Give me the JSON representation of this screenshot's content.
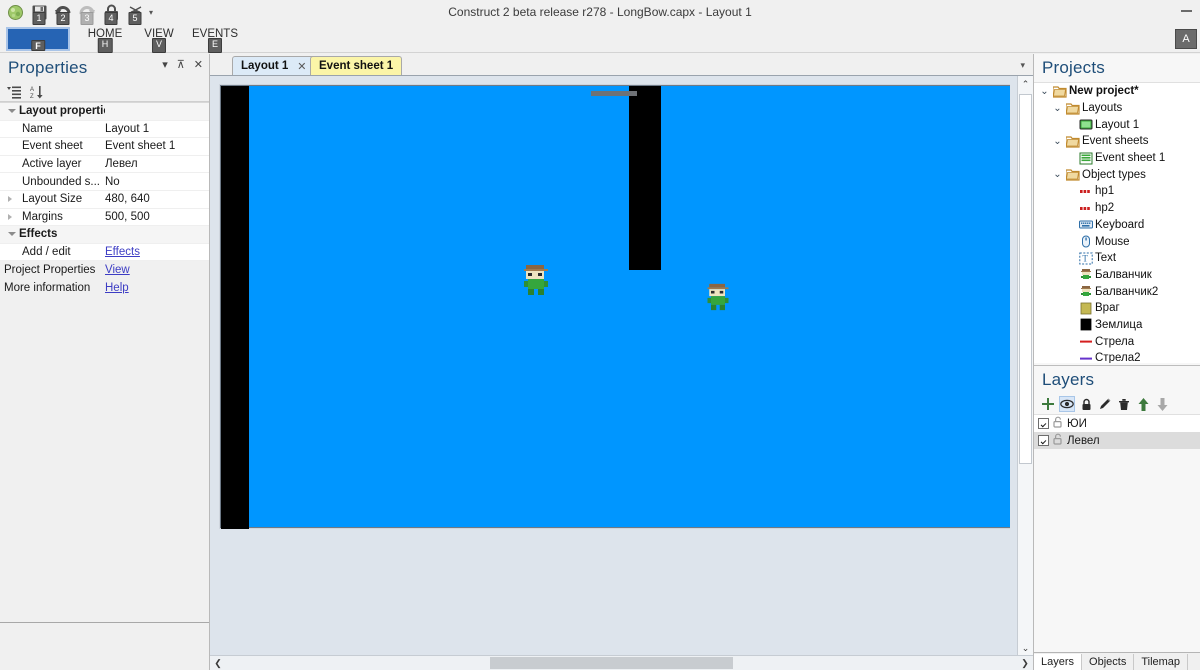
{
  "window": {
    "title": "Construct 2 beta release r278 - LongBow.capx - Layout 1",
    "minimize_label": "—",
    "ribbon_keytip": "A"
  },
  "quick_access": {
    "items": [
      {
        "name": "construct-logo",
        "keytip": ""
      },
      {
        "name": "save-icon",
        "keytip": "1"
      },
      {
        "name": "undo-icon",
        "keytip": "2"
      },
      {
        "name": "redo-icon",
        "keytip": "3"
      },
      {
        "name": "preview-icon",
        "keytip": "4"
      },
      {
        "name": "debug-icon",
        "keytip": "5"
      }
    ]
  },
  "ribbon": {
    "tabs": [
      {
        "label": "",
        "keytip": "F",
        "active": true
      },
      {
        "label": "HOME",
        "keytip": "H",
        "active": false
      },
      {
        "label": "VIEW",
        "keytip": "V",
        "active": false
      },
      {
        "label": "EVENTS",
        "keytip": "E",
        "active": false
      }
    ]
  },
  "properties": {
    "title": "Properties",
    "header_buttons": [
      "▾",
      "⊼",
      "✕"
    ],
    "toolbar": [
      "categorize-icon",
      "sort-alpha-icon"
    ],
    "rows": [
      {
        "key": "Layout properties",
        "value": "",
        "group": true,
        "expander": "down"
      },
      {
        "key": "Name",
        "value": "Layout 1",
        "group": false,
        "expander": ""
      },
      {
        "key": "Event sheet",
        "value": "Event sheet 1",
        "group": false,
        "expander": ""
      },
      {
        "key": "Active layer",
        "value": "Левел",
        "group": false,
        "expander": ""
      },
      {
        "key": "Unbounded s...",
        "value": "No",
        "group": false,
        "expander": ""
      },
      {
        "key": "Layout Size",
        "value": "480, 640",
        "group": false,
        "expander": "right"
      },
      {
        "key": "Margins",
        "value": "500, 500",
        "group": false,
        "expander": "right"
      },
      {
        "key": "Effects",
        "value": "",
        "group": true,
        "expander": "down"
      },
      {
        "key": "Add / edit",
        "value": "Effects",
        "group": false,
        "expander": "",
        "link": true
      }
    ],
    "footer_rows": [
      {
        "key": "Project Properties",
        "value": "View",
        "link": true
      },
      {
        "key": "More information",
        "value": "Help",
        "link": true
      }
    ]
  },
  "editor": {
    "tabs": [
      {
        "label": "Layout 1",
        "kind": "layout",
        "active": true,
        "closable": true,
        "close_label": "✕"
      },
      {
        "label": "Event sheet 1",
        "kind": "sheet",
        "active": false,
        "closable": false,
        "close_label": ""
      }
    ],
    "tabstrip_dropdown": "▾",
    "scroll": {
      "v_up": "⌃",
      "v_down": "⌄",
      "h_left": "❮",
      "h_right": "❯"
    },
    "canvas": {
      "background_color": "#0096ff",
      "surround_color": "#dde4ec",
      "objects": [
        {
          "name": "wall-left",
          "type": "Землица",
          "color": "#000000"
        },
        {
          "name": "wall-middle",
          "type": "Землица",
          "color": "#000000"
        },
        {
          "name": "bar-top",
          "type": "Стрела",
          "color": "#6f7276"
        },
        {
          "name": "character-1",
          "type": "Балванчик"
        },
        {
          "name": "character-2",
          "type": "Балванчик2"
        }
      ]
    }
  },
  "projects": {
    "title": "Projects",
    "tree": [
      {
        "label": "New project*",
        "indent": 0,
        "twisty": "⌄",
        "icon": "folder-icon",
        "bold": true
      },
      {
        "label": "Layouts",
        "indent": 1,
        "twisty": "⌄",
        "icon": "folder-icon",
        "bold": false
      },
      {
        "label": "Layout 1",
        "indent": 2,
        "twisty": "",
        "icon": "layout-icon",
        "bold": false
      },
      {
        "label": "Event sheets",
        "indent": 1,
        "twisty": "⌄",
        "icon": "folder-icon",
        "bold": false
      },
      {
        "label": "Event sheet 1",
        "indent": 2,
        "twisty": "",
        "icon": "eventsheet-icon",
        "bold": false
      },
      {
        "label": "Object types",
        "indent": 1,
        "twisty": "⌄",
        "icon": "folder-icon",
        "bold": false
      },
      {
        "label": "hp1",
        "indent": 2,
        "twisty": "",
        "icon": "sprite-red-icon",
        "bold": false
      },
      {
        "label": "hp2",
        "indent": 2,
        "twisty": "",
        "icon": "sprite-red-icon",
        "bold": false
      },
      {
        "label": "Keyboard",
        "indent": 2,
        "twisty": "",
        "icon": "keyboard-icon",
        "bold": false
      },
      {
        "label": "Mouse",
        "indent": 2,
        "twisty": "",
        "icon": "mouse-icon",
        "bold": false
      },
      {
        "label": "Text",
        "indent": 2,
        "twisty": "",
        "icon": "text-icon",
        "bold": false
      },
      {
        "label": "Балванчик",
        "indent": 2,
        "twisty": "",
        "icon": "character-icon",
        "bold": false
      },
      {
        "label": "Балванчик2",
        "indent": 2,
        "twisty": "",
        "icon": "character-icon",
        "bold": false
      },
      {
        "label": "Враг",
        "indent": 2,
        "twisty": "",
        "icon": "khaki-square-icon",
        "bold": false
      },
      {
        "label": "Землица",
        "indent": 2,
        "twisty": "",
        "icon": "black-square-icon",
        "bold": false
      },
      {
        "label": "Стрела",
        "indent": 2,
        "twisty": "",
        "icon": "red-line-icon",
        "bold": false
      },
      {
        "label": "Стрела2",
        "indent": 2,
        "twisty": "",
        "icon": "purple-line-icon",
        "bold": false
      }
    ]
  },
  "layers": {
    "title": "Layers",
    "toolbar": [
      {
        "name": "add-layer-icon",
        "glyph": "✚",
        "active": false
      },
      {
        "name": "eye-visibility-icon",
        "glyph": "👁",
        "active": true
      },
      {
        "name": "lock-icon",
        "glyph": "🔒",
        "active": false
      },
      {
        "name": "pencil-rename-icon",
        "glyph": "✎",
        "active": false
      },
      {
        "name": "trash-delete-icon",
        "glyph": "🗑",
        "active": false
      },
      {
        "name": "move-up-icon",
        "glyph": "⬆",
        "active": false
      },
      {
        "name": "move-down-icon",
        "glyph": "⬇",
        "active": false
      }
    ],
    "items": [
      {
        "label": "ЮИ",
        "visible": true,
        "locked": false,
        "selected": false
      },
      {
        "label": "Левел",
        "visible": true,
        "locked": false,
        "selected": true
      }
    ]
  },
  "bottom_tabs": [
    {
      "label": "Layers",
      "active": true
    },
    {
      "label": "Objects",
      "active": false
    },
    {
      "label": "Tilemap",
      "active": false
    }
  ]
}
